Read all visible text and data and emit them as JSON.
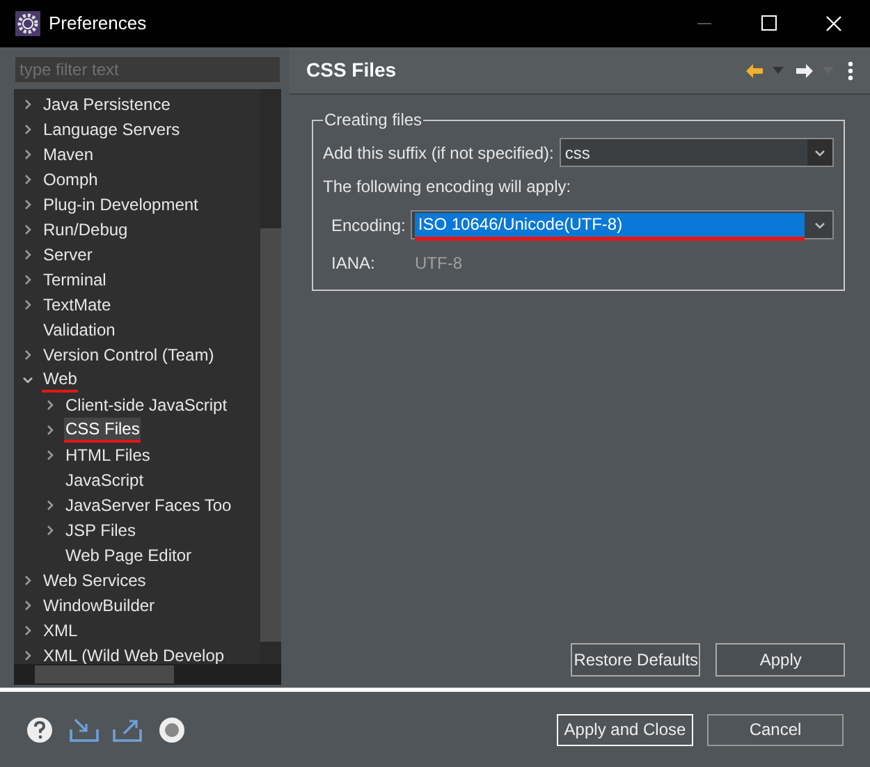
{
  "window": {
    "title": "Preferences"
  },
  "filter": {
    "placeholder": "type filter text"
  },
  "tree": [
    {
      "label": "Java Persistence",
      "expanded": false,
      "selected": false
    },
    {
      "label": "Language Servers",
      "expanded": false,
      "selected": false
    },
    {
      "label": "Maven",
      "expanded": false,
      "selected": false
    },
    {
      "label": "Oomph",
      "expanded": false,
      "selected": false
    },
    {
      "label": "Plug-in Development",
      "expanded": false,
      "selected": false
    },
    {
      "label": "Run/Debug",
      "expanded": false,
      "selected": false
    },
    {
      "label": "Server",
      "expanded": false,
      "selected": false
    },
    {
      "label": "Terminal",
      "expanded": false,
      "selected": false
    },
    {
      "label": "TextMate",
      "expanded": false,
      "selected": false
    },
    {
      "label": "Validation",
      "selected": false
    },
    {
      "label": "Version Control (Team)",
      "expanded": false,
      "selected": false
    },
    {
      "label": "Web",
      "expanded": true,
      "selected": false,
      "annotated": true,
      "children": [
        {
          "label": "Client-side JavaScript",
          "expanded": false,
          "selected": false
        },
        {
          "label": "CSS Files",
          "expanded": false,
          "selected": true,
          "annotated": true
        },
        {
          "label": "HTML Files",
          "expanded": false,
          "selected": false
        },
        {
          "label": "JavaScript",
          "selected": false
        },
        {
          "label": "JavaServer Faces Too",
          "expanded": false,
          "selected": false
        },
        {
          "label": "JSP Files",
          "expanded": false,
          "selected": false
        },
        {
          "label": "Web Page Editor",
          "selected": false
        }
      ]
    },
    {
      "label": "Web Services",
      "expanded": false,
      "selected": false
    },
    {
      "label": "WindowBuilder",
      "expanded": false,
      "selected": false
    },
    {
      "label": "XML",
      "expanded": false,
      "selected": false
    },
    {
      "label": "XML (Wild Web Develop",
      "expanded": false,
      "selected": false
    }
  ],
  "page": {
    "title": "CSS Files",
    "group": {
      "title": "Creating files",
      "suffix": {
        "label": "Add this suffix (if not specified):",
        "value": "css"
      },
      "note": "The following encoding will apply:",
      "encoding": {
        "label": "Encoding:",
        "value": "ISO 10646/Unicode(UTF-8)",
        "annotated": true
      },
      "iana": {
        "label": "IANA:",
        "value": "UTF-8"
      }
    },
    "buttons": [
      "Restore Defaults",
      "Apply"
    ]
  },
  "footer_buttons": [
    "Apply and Close",
    "Cancel"
  ]
}
